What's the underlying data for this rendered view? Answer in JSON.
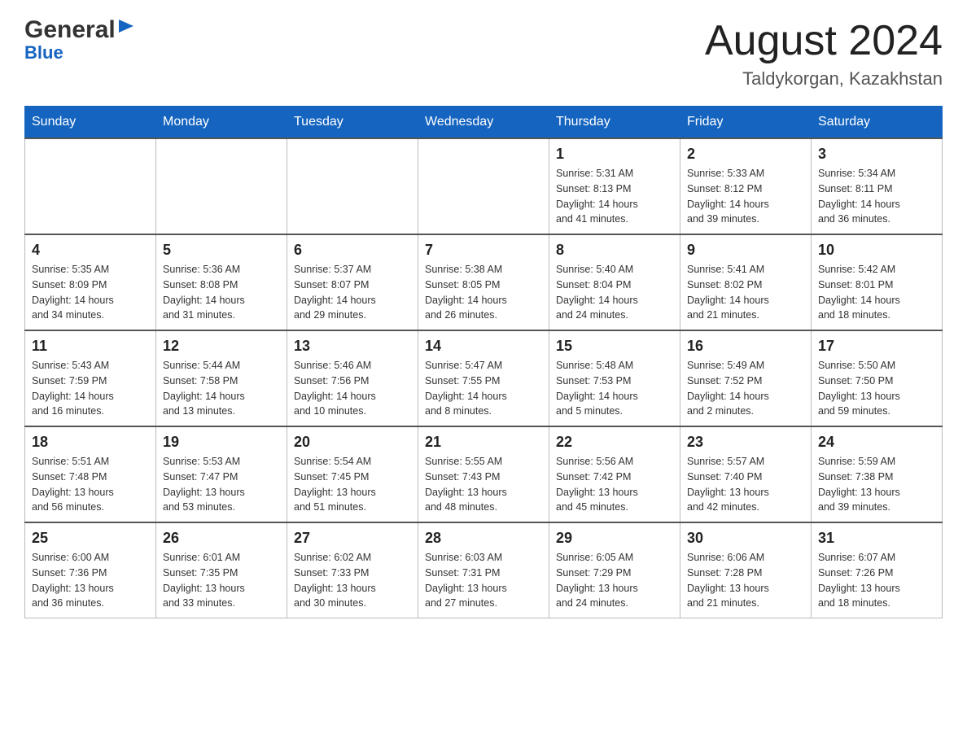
{
  "header": {
    "logo_general": "General",
    "logo_blue": "Blue",
    "title": "August 2024",
    "subtitle": "Taldykorgan, Kazakhstan"
  },
  "weekdays": [
    "Sunday",
    "Monday",
    "Tuesday",
    "Wednesday",
    "Thursday",
    "Friday",
    "Saturday"
  ],
  "weeks": [
    [
      {
        "day": "",
        "info": ""
      },
      {
        "day": "",
        "info": ""
      },
      {
        "day": "",
        "info": ""
      },
      {
        "day": "",
        "info": ""
      },
      {
        "day": "1",
        "info": "Sunrise: 5:31 AM\nSunset: 8:13 PM\nDaylight: 14 hours\nand 41 minutes."
      },
      {
        "day": "2",
        "info": "Sunrise: 5:33 AM\nSunset: 8:12 PM\nDaylight: 14 hours\nand 39 minutes."
      },
      {
        "day": "3",
        "info": "Sunrise: 5:34 AM\nSunset: 8:11 PM\nDaylight: 14 hours\nand 36 minutes."
      }
    ],
    [
      {
        "day": "4",
        "info": "Sunrise: 5:35 AM\nSunset: 8:09 PM\nDaylight: 14 hours\nand 34 minutes."
      },
      {
        "day": "5",
        "info": "Sunrise: 5:36 AM\nSunset: 8:08 PM\nDaylight: 14 hours\nand 31 minutes."
      },
      {
        "day": "6",
        "info": "Sunrise: 5:37 AM\nSunset: 8:07 PM\nDaylight: 14 hours\nand 29 minutes."
      },
      {
        "day": "7",
        "info": "Sunrise: 5:38 AM\nSunset: 8:05 PM\nDaylight: 14 hours\nand 26 minutes."
      },
      {
        "day": "8",
        "info": "Sunrise: 5:40 AM\nSunset: 8:04 PM\nDaylight: 14 hours\nand 24 minutes."
      },
      {
        "day": "9",
        "info": "Sunrise: 5:41 AM\nSunset: 8:02 PM\nDaylight: 14 hours\nand 21 minutes."
      },
      {
        "day": "10",
        "info": "Sunrise: 5:42 AM\nSunset: 8:01 PM\nDaylight: 14 hours\nand 18 minutes."
      }
    ],
    [
      {
        "day": "11",
        "info": "Sunrise: 5:43 AM\nSunset: 7:59 PM\nDaylight: 14 hours\nand 16 minutes."
      },
      {
        "day": "12",
        "info": "Sunrise: 5:44 AM\nSunset: 7:58 PM\nDaylight: 14 hours\nand 13 minutes."
      },
      {
        "day": "13",
        "info": "Sunrise: 5:46 AM\nSunset: 7:56 PM\nDaylight: 14 hours\nand 10 minutes."
      },
      {
        "day": "14",
        "info": "Sunrise: 5:47 AM\nSunset: 7:55 PM\nDaylight: 14 hours\nand 8 minutes."
      },
      {
        "day": "15",
        "info": "Sunrise: 5:48 AM\nSunset: 7:53 PM\nDaylight: 14 hours\nand 5 minutes."
      },
      {
        "day": "16",
        "info": "Sunrise: 5:49 AM\nSunset: 7:52 PM\nDaylight: 14 hours\nand 2 minutes."
      },
      {
        "day": "17",
        "info": "Sunrise: 5:50 AM\nSunset: 7:50 PM\nDaylight: 13 hours\nand 59 minutes."
      }
    ],
    [
      {
        "day": "18",
        "info": "Sunrise: 5:51 AM\nSunset: 7:48 PM\nDaylight: 13 hours\nand 56 minutes."
      },
      {
        "day": "19",
        "info": "Sunrise: 5:53 AM\nSunset: 7:47 PM\nDaylight: 13 hours\nand 53 minutes."
      },
      {
        "day": "20",
        "info": "Sunrise: 5:54 AM\nSunset: 7:45 PM\nDaylight: 13 hours\nand 51 minutes."
      },
      {
        "day": "21",
        "info": "Sunrise: 5:55 AM\nSunset: 7:43 PM\nDaylight: 13 hours\nand 48 minutes."
      },
      {
        "day": "22",
        "info": "Sunrise: 5:56 AM\nSunset: 7:42 PM\nDaylight: 13 hours\nand 45 minutes."
      },
      {
        "day": "23",
        "info": "Sunrise: 5:57 AM\nSunset: 7:40 PM\nDaylight: 13 hours\nand 42 minutes."
      },
      {
        "day": "24",
        "info": "Sunrise: 5:59 AM\nSunset: 7:38 PM\nDaylight: 13 hours\nand 39 minutes."
      }
    ],
    [
      {
        "day": "25",
        "info": "Sunrise: 6:00 AM\nSunset: 7:36 PM\nDaylight: 13 hours\nand 36 minutes."
      },
      {
        "day": "26",
        "info": "Sunrise: 6:01 AM\nSunset: 7:35 PM\nDaylight: 13 hours\nand 33 minutes."
      },
      {
        "day": "27",
        "info": "Sunrise: 6:02 AM\nSunset: 7:33 PM\nDaylight: 13 hours\nand 30 minutes."
      },
      {
        "day": "28",
        "info": "Sunrise: 6:03 AM\nSunset: 7:31 PM\nDaylight: 13 hours\nand 27 minutes."
      },
      {
        "day": "29",
        "info": "Sunrise: 6:05 AM\nSunset: 7:29 PM\nDaylight: 13 hours\nand 24 minutes."
      },
      {
        "day": "30",
        "info": "Sunrise: 6:06 AM\nSunset: 7:28 PM\nDaylight: 13 hours\nand 21 minutes."
      },
      {
        "day": "31",
        "info": "Sunrise: 6:07 AM\nSunset: 7:26 PM\nDaylight: 13 hours\nand 18 minutes."
      }
    ]
  ]
}
